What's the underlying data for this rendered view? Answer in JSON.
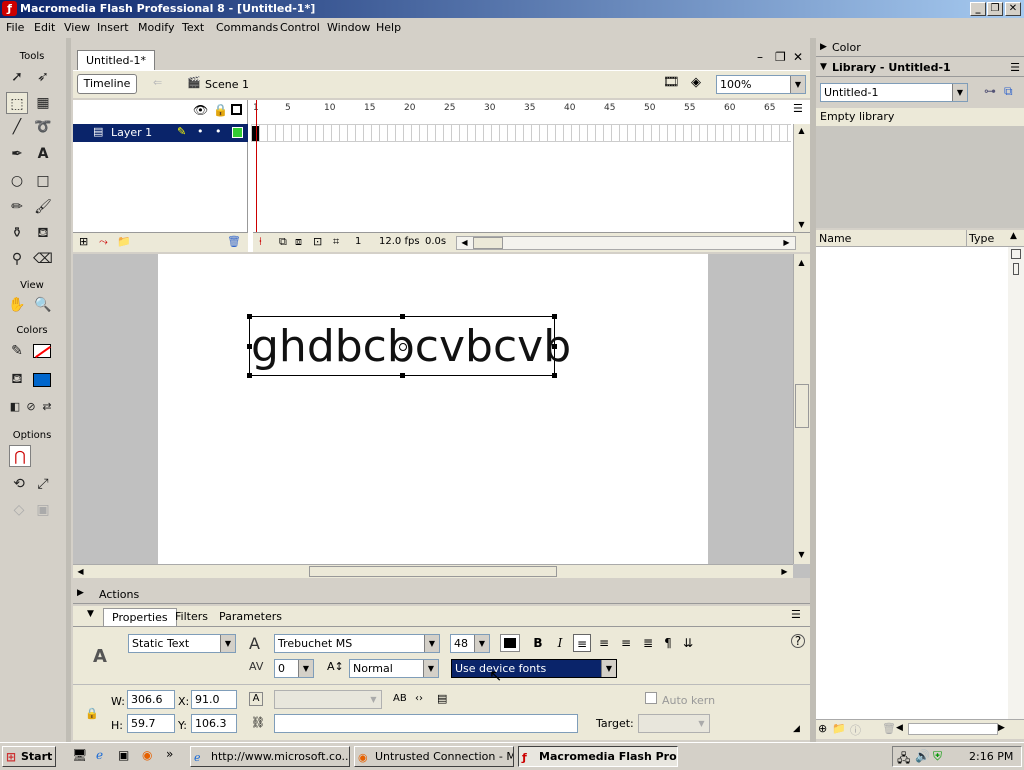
{
  "window": {
    "title": "Macromedia Flash Professional 8 - [Untitled-1*]",
    "controls": {
      "minimize": "_",
      "restore": "❐",
      "close": "✕"
    }
  },
  "menubar": [
    "File",
    "Edit",
    "View",
    "Insert",
    "Modify",
    "Text",
    "Commands",
    "Control",
    "Window",
    "Help"
  ],
  "tools": {
    "header": "Tools",
    "view_header": "View",
    "colors_header": "Colors",
    "options_header": "Options",
    "stroke_color": "#ff0000",
    "fill_color": "#0066cc"
  },
  "document": {
    "tab": "Untitled-1*",
    "timeline_button": "Timeline",
    "scene": "Scene 1",
    "zoom": "100%"
  },
  "timeline": {
    "layer_name": "Layer 1",
    "frame_numbers": [
      "1",
      "5",
      "10",
      "15",
      "20",
      "25",
      "30",
      "35",
      "40",
      "45",
      "50",
      "55",
      "60",
      "65"
    ],
    "current_frame": "1",
    "frame_rate": "12.0 fps",
    "elapsed": "0.0s"
  },
  "stage": {
    "text": "ghdbcbcvbcvb"
  },
  "right_panels": {
    "color_label": "Color",
    "library_label": "Library - Untitled-1",
    "library_doc": "Untitled-1",
    "empty_library": "Empty library",
    "col_name": "Name",
    "col_type": "Type"
  },
  "actions_label": "Actions",
  "properties": {
    "tabs": [
      "Properties",
      "Filters",
      "Parameters"
    ],
    "text_type": "Static Text",
    "font": "Trebuchet MS",
    "font_size": "48",
    "letter_spacing": "0",
    "char_position": "Normal",
    "rendering": "Use device fonts",
    "text_color": "#000000",
    "w_label": "W:",
    "w": "306.6",
    "x_label": "X:",
    "x": "91.0",
    "h_label": "H:",
    "h": "59.7",
    "y_label": "Y:",
    "y": "106.3",
    "auto_kern": "Auto kern",
    "target_label": "Target:",
    "bold": "B",
    "italic": "I"
  },
  "taskbar": {
    "start": "Start",
    "tasks": [
      "http://www.microsoft.co...",
      "Untrusted Connection - M...",
      "Macromedia Flash Pro..."
    ],
    "clock": "2:16 PM"
  }
}
